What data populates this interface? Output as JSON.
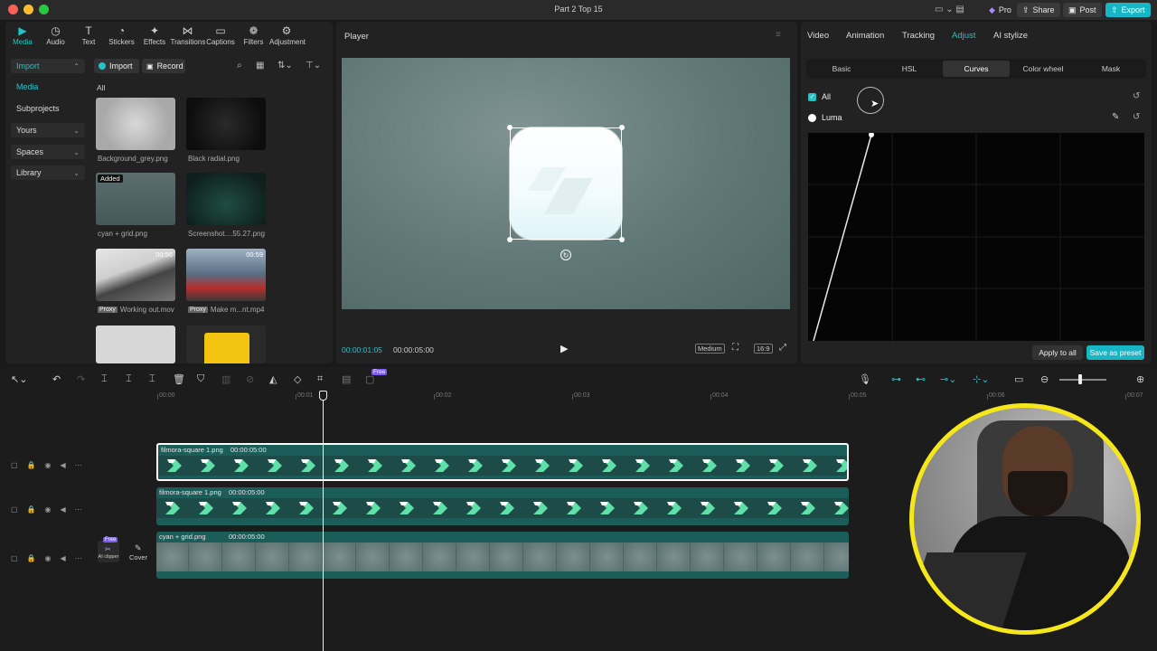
{
  "window": {
    "title": "Part 2 Top 15"
  },
  "titlebar": {
    "pro": "Pro",
    "share": "Share",
    "post": "Post",
    "export": "Export"
  },
  "toolbar": [
    {
      "label": "Media",
      "icon": "media-icon",
      "glyph": "▶"
    },
    {
      "label": "Audio",
      "icon": "audio-icon",
      "glyph": "◷"
    },
    {
      "label": "Text",
      "icon": "text-icon",
      "glyph": "T"
    },
    {
      "label": "Stickers",
      "icon": "stickers-icon",
      "glyph": "◔"
    },
    {
      "label": "Effects",
      "icon": "effects-icon",
      "glyph": "✦"
    },
    {
      "label": "Transitions",
      "icon": "transitions-icon",
      "glyph": "⋈"
    },
    {
      "label": "Captions",
      "icon": "captions-icon",
      "glyph": "▭"
    },
    {
      "label": "Filters",
      "icon": "filters-icon",
      "glyph": "❁"
    },
    {
      "label": "Adjustment",
      "icon": "adjustment-icon",
      "glyph": "⚙"
    }
  ],
  "sidebar": {
    "items": [
      {
        "label": "Import",
        "chev": "⌃",
        "active": true
      },
      {
        "label": "Media",
        "active": false,
        "accent": true
      },
      {
        "label": "Subprojects"
      },
      {
        "label": "Yours",
        "chev": "⌄"
      },
      {
        "label": "Spaces",
        "chev": "⌄"
      },
      {
        "label": "Library",
        "chev": "⌄"
      }
    ]
  },
  "media": {
    "import_btn": "Import",
    "record_btn": "Record",
    "filter_all": "All",
    "items": [
      {
        "name": "Background_grey.png",
        "badge": "",
        "duration": ""
      },
      {
        "name": "Black radial.png",
        "badge": "",
        "duration": ""
      },
      {
        "name": "cyan + grid.png",
        "badge": "Added",
        "duration": ""
      },
      {
        "name": "Screenshot....55.27.png",
        "badge": "",
        "duration": ""
      },
      {
        "name": "Working out.mov",
        "badge": "Proxy",
        "duration": "00:56"
      },
      {
        "name": "Make m...nt.mp4",
        "badge": "Proxy",
        "duration": "00:59"
      }
    ]
  },
  "player": {
    "title": "Player",
    "current_time": "00:00:01:05",
    "total_time": "00:00:05:00",
    "quality": "Medium",
    "ratio": "16:9"
  },
  "inspector": {
    "tabs": [
      "Video",
      "Animation",
      "Tracking",
      "Adjust",
      "AI stylize"
    ],
    "active_tab": "Adjust",
    "subtabs": [
      "Basic",
      "HSL",
      "Curves",
      "Color wheel",
      "Mask"
    ],
    "active_subtab": "Curves",
    "all_label": "All",
    "luma_label": "Luma",
    "apply_all": "Apply to all",
    "save_preset": "Save as preset"
  },
  "timeline": {
    "ruler": [
      "00:00",
      "00:01",
      "00:02",
      "00:03",
      "00:04",
      "00:05",
      "00:06",
      "00:07"
    ],
    "free_badge": "Free",
    "ai_clipper": "AI clipper",
    "cover": "Cover",
    "tracks": [
      {
        "clip_name": "filmora-square 1.png",
        "clip_time": "00:00:05:00"
      },
      {
        "clip_name": "filmora-square 1.png",
        "clip_time": "00:00:05:00"
      },
      {
        "clip_name": "cyan + grid.png",
        "clip_time": "00:00:05:00"
      }
    ],
    "playhead_time_fraction": 0.24
  },
  "colors": {
    "accent": "#23c3c8",
    "clip_teal": "#1f6a64",
    "chevron_green": "#5fe0a8",
    "webcam_ring": "#f5e71a",
    "export": "#19b5c5"
  }
}
